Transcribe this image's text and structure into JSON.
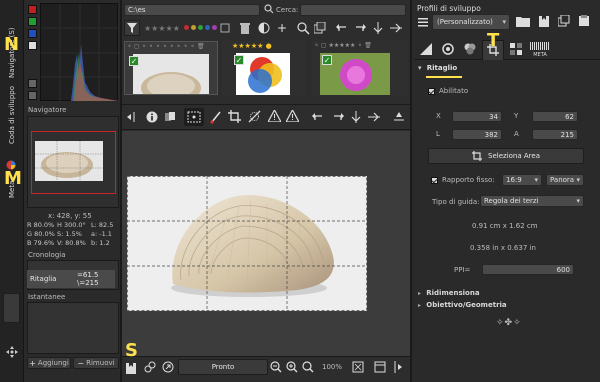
{
  "hints": {
    "n": "N",
    "m": "M",
    "s": "S",
    "t": "T"
  },
  "left_vertical_tabs": {
    "navigator": "Navigatore (S)",
    "queue": "Coda di sviluppo",
    "meta": "Meta"
  },
  "navigator": {
    "title": "Navigatore",
    "coords": "x: 428, y: 55",
    "row1_c1": "R 80.0%",
    "row1_c2": "H 300.0°",
    "row1_c3": "L: 82.5",
    "row2_c1": "G 80.0%",
    "row2_c2": "S: 1.5%",
    "row2_c3": "a: -1.1",
    "row3_c1": "B 79.6%",
    "row3_c2": "V: 80.8%",
    "row3_c3": "b: 1.2"
  },
  "history": {
    "title": "Cronologia",
    "item_label": "Ritaglia",
    "item_value1": "=61.5",
    "item_value2": "\\=215"
  },
  "snapshots": {
    "title": "Istantanee",
    "add_label": "Aggiungi",
    "remove_label": "Rimuovi"
  },
  "filebrowser": {
    "path": "C:\\es",
    "search_label": "Cerca:",
    "search_value": ""
  },
  "status": {
    "ready_label": "Pronto",
    "zoom": "100%"
  },
  "right_panel": {
    "profiles_title": "Profili di sviluppo",
    "profile_value": "(Personalizzato)",
    "tab_meta_label": "META",
    "crop_section": "Ritaglio",
    "enabled_label": "Abilitato",
    "x_label": "X",
    "x_value": "34",
    "y_label": "Y",
    "y_value": "62",
    "l_label": "L",
    "l_value": "382",
    "a_label": "A",
    "a_value": "215",
    "select_area_label": "Seleziona Area",
    "fixed_ratio_label": "Rapporto fisso:",
    "ratio_value": "16:9",
    "orientation_value": "Panora",
    "guide_label": "Tipo di guida:",
    "guide_value": "Regola dei terzi",
    "size_cm": "0.91 cm x 1.62 cm",
    "size_in": "0.358 in x 0.637 in",
    "ppi_label": "PPI=",
    "ppi_value": "600",
    "resize_section": "Ridimensiona",
    "lens_section": "Obiettivo/Geometria"
  },
  "colors": {
    "accent_yellow": "#ffe14d",
    "panel_bg": "#2a2a2a",
    "canvas_bg": "#3a3a3a",
    "navigator_frame": "#c8252a"
  }
}
